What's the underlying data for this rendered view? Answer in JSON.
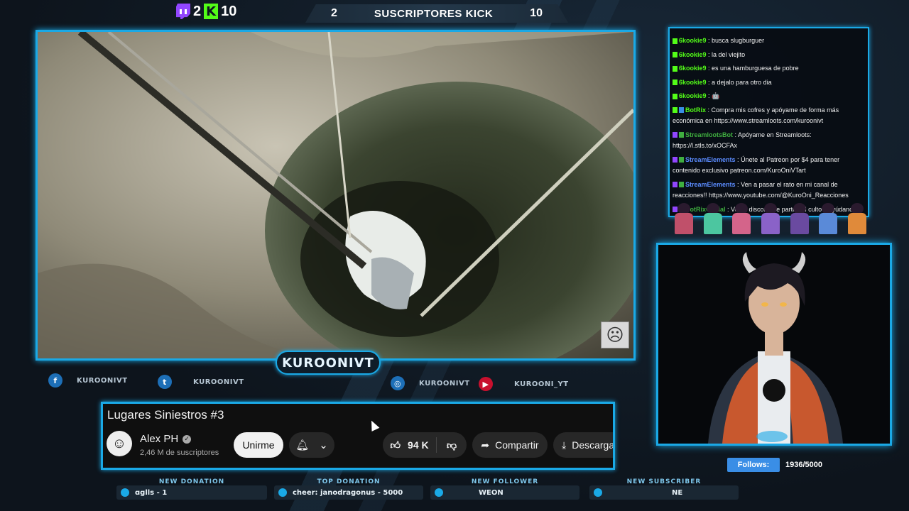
{
  "counters": {
    "twitch_subs": "2",
    "kick_subs": "10"
  },
  "sub_goal": {
    "current": "2",
    "title": "SUSCRIPTORES KICK",
    "target": "10"
  },
  "streamer_badge": "KUROONIVT",
  "socials": [
    {
      "icon": "facebook-icon",
      "glyph": "f",
      "handle": "KUROONIVT"
    },
    {
      "icon": "twitter-icon",
      "glyph": "t",
      "handle": "KUROONIVT"
    },
    {
      "icon": "instagram-icon",
      "glyph": "◎",
      "handle": "KUROONIVT"
    },
    {
      "icon": "youtube-icon",
      "glyph": "▶",
      "handle": "KUROONI_YT"
    }
  ],
  "youtube": {
    "video_title": "Lugares Siniestros #3",
    "channel_name": "Alex PH",
    "subscribers": "2,46 M de suscriptores",
    "join_label": "Unirme",
    "likes": "94 K",
    "share_label": "Compartir",
    "download_label": "Descarga"
  },
  "alerts": [
    {
      "caption": "NEW DONATION",
      "value": "ɑglls - 1"
    },
    {
      "caption": "TOP DONATION",
      "value": "cheer: janodragonus - 5000"
    },
    {
      "caption": "NEW FOLLOWER",
      "value": "WEON"
    },
    {
      "caption": "NEW SUBSCRIBER",
      "value": "NE"
    }
  ],
  "chat": [
    {
      "user": "6kookie9",
      "color": "#53fc18",
      "msg": "busca slugburguer"
    },
    {
      "user": "6kookie9",
      "color": "#53fc18",
      "msg": "la del viejito"
    },
    {
      "user": "6kookie9",
      "color": "#53fc18",
      "msg": "es una hamburguesa de pobre"
    },
    {
      "user": "6kookie9",
      "color": "#53fc18",
      "msg": "a dejalo para otro dia"
    },
    {
      "user": "6kookie9",
      "color": "#53fc18",
      "msg": "🤖"
    },
    {
      "user": "BotRix",
      "color": "#53fc18",
      "msg": "Compra mis cofres y apóyame de forma más económica en https://www.streamloots.com/kuroonivt"
    },
    {
      "user": "StreamlootsBot",
      "color": "#3fae3f",
      "msg": "Apóyame en Streamloots: https://l.stls.to/xOCFAx"
    },
    {
      "user": "StreamElements",
      "color": "#5b8cff",
      "msg": "Únete al Patreon por $4 para tener contenido exclusivo patreon.com/KuroOniVTart"
    },
    {
      "user": "StreamElements",
      "color": "#5b8cff",
      "msg": "Ven a pasar el rato en mi canal de reacciones!! https://www.youtube.com/@KuroOni_Reacciones"
    },
    {
      "user": "BotRixOficial",
      "color": "#3fae3f",
      "msg": "Ven a discord, se parte del culto y ayúdanos a"
    }
  ],
  "follows": {
    "label": "Follows:",
    "count": "1936/5000"
  }
}
